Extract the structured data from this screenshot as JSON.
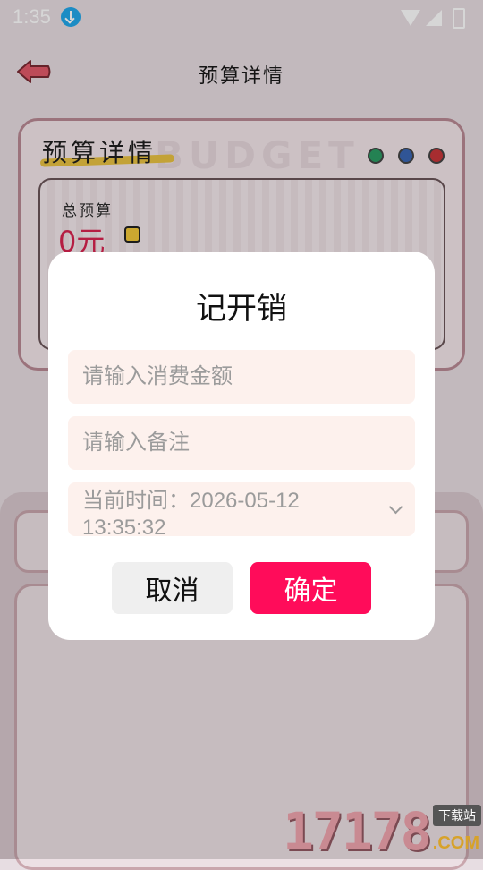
{
  "status_bar": {
    "time": "1:35"
  },
  "header": {
    "title": "预算详情"
  },
  "budget_card": {
    "title": "预算详情",
    "bg_text": "BUDGET",
    "total_label": "总预算",
    "total_value": "0元"
  },
  "dialog": {
    "title": "记开销",
    "amount_placeholder": "请输入消费金额",
    "note_placeholder": "请输入备注",
    "time_text": "当前时间：2026-05-12 13:35:32",
    "cancel_label": "取消",
    "confirm_label": "确定"
  },
  "watermark": {
    "number": "17178",
    "tag": "下载站",
    "suffix": ".COM"
  },
  "colors": {
    "accent": "#ff0c5a",
    "field_bg": "#fdf1ed",
    "value_red": "#d8234f"
  }
}
